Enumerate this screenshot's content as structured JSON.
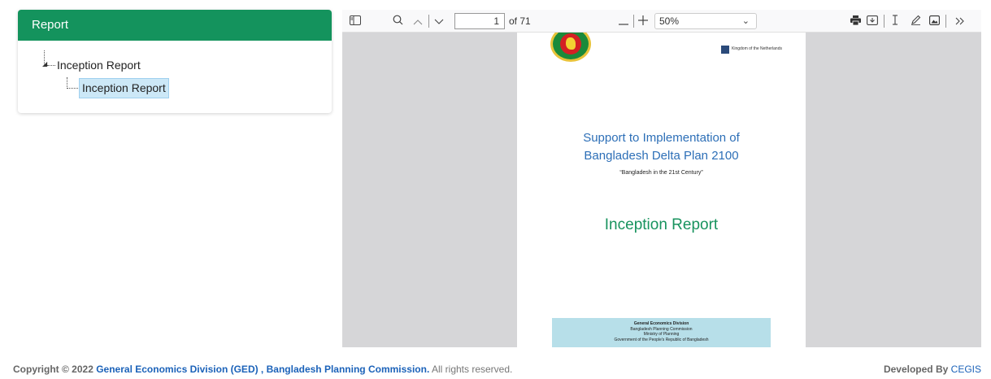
{
  "report_panel": {
    "title": "Report",
    "tree": {
      "parent_label": "Inception Report",
      "child_label": "Inception Report"
    }
  },
  "pdf_viewer": {
    "current_page": "1",
    "total_pages": "of 71",
    "zoom": "50%",
    "page_content": {
      "partner_text": "Kingdom of the Netherlands",
      "title_line1": "Support to Implementation of",
      "title_line2": "Bangladesh Delta Plan 2100",
      "subtitle": "“Bangladesh in the 21st Century”",
      "report_title": "Inception Report",
      "footer_lines": [
        "General Economics Division",
        "Bangladesh Planning Commission",
        "Ministry of Planning",
        "Government of the People's Republic of Bangladesh"
      ]
    }
  },
  "footer": {
    "copyright_prefix": "Copyright © 2022",
    "organization": "General Economics Division (GED) , Bangladesh Planning Commission.",
    "rights": "All rights reserved.",
    "developed_by": "Developed By",
    "developer": "CEGIS"
  },
  "colors": {
    "header_green": "#14935d",
    "link_blue": "#1b62b9",
    "selected_bg": "#cce8f7"
  }
}
